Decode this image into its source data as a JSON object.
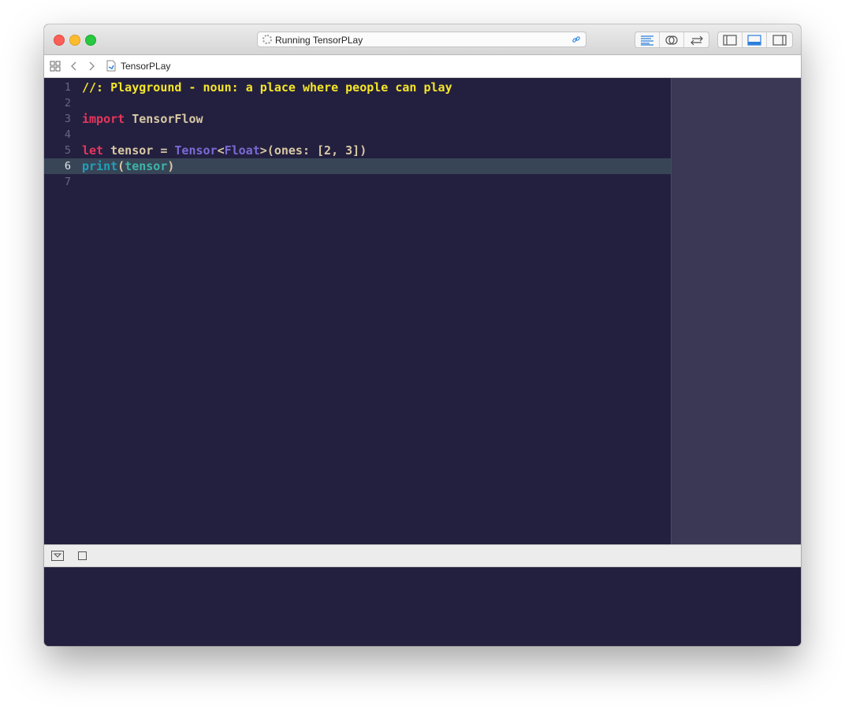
{
  "titlebar": {
    "activity_text": "Running TensorPLay"
  },
  "navbar": {
    "file_name": "TensorPLay"
  },
  "code": {
    "lines": [
      {
        "number": "1",
        "tokens": [
          {
            "t": "//: Playground - noun: a place where people can play",
            "k": "comment"
          }
        ]
      },
      {
        "number": "2",
        "tokens": []
      },
      {
        "number": "3",
        "tokens": [
          {
            "t": "import",
            "k": "kw"
          },
          {
            "t": " TensorFlow",
            "k": "plain"
          }
        ]
      },
      {
        "number": "4",
        "tokens": []
      },
      {
        "number": "5",
        "tokens": [
          {
            "t": "let",
            "k": "kw"
          },
          {
            "t": " tensor = ",
            "k": "plain"
          },
          {
            "t": "Tensor",
            "k": "type"
          },
          {
            "t": "<",
            "k": "plain"
          },
          {
            "t": "Float",
            "k": "type"
          },
          {
            "t": ">(ones: [2, 3])",
            "k": "plain"
          }
        ]
      },
      {
        "number": "6",
        "tokens": [
          {
            "t": "print",
            "k": "func"
          },
          {
            "t": "(",
            "k": "plain"
          },
          {
            "t": "tensor",
            "k": "var"
          },
          {
            "t": ")",
            "k": "plain"
          }
        ],
        "active": true
      },
      {
        "number": "7",
        "tokens": []
      }
    ]
  },
  "theme": {
    "editor_bg": "#23203f",
    "results_bg": "#3a3854",
    "active_line_bg": "#384557",
    "comment_color": "#f5e629",
    "keyword_color": "#e8355c",
    "type_color": "#7a6ad6",
    "func_color": "#1fa0b9"
  }
}
